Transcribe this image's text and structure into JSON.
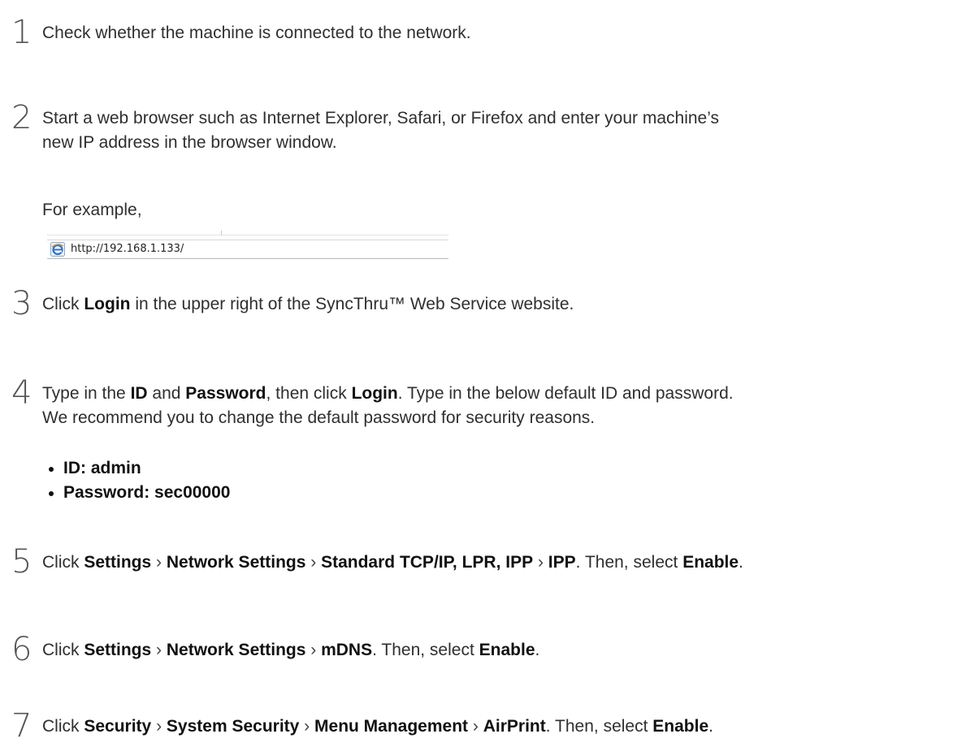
{
  "steps": [
    {
      "num": "1",
      "text": "Check whether the machine is connected to the network."
    },
    {
      "num": "2",
      "line1": "Start a web browser such as Internet Explorer, Safari, or Firefox and enter your machine’s",
      "line2": "new IP address in the browser window.",
      "example_label": "For example,",
      "address_url": "http://192.168.1.133/"
    },
    {
      "num": "3",
      "pre": "Click ",
      "login": "Login",
      "post": " in the upper right of the SyncThru™ Web Service website."
    },
    {
      "num": "4",
      "t1": "Type in the ",
      "id": "ID",
      "t2": " and ",
      "password": "Password",
      "t3": ", then click ",
      "login": "Login",
      "t4": ". Type in the below default ID and password.",
      "line2": "We recommend you to change the default password for security reasons.",
      "bullets": [
        "ID: admin",
        "Password: sec00000"
      ]
    },
    {
      "num": "5",
      "pre": "Click ",
      "items": [
        "Settings",
        "Network Settings",
        "Standard TCP/IP, LPR, IPP",
        "IPP"
      ],
      "then": ". Then, select ",
      "enable": "Enable",
      "end": "."
    },
    {
      "num": "6",
      "pre": "Click ",
      "items": [
        "Settings",
        "Network Settings",
        "mDNS"
      ],
      "then": ". Then, select ",
      "enable": "Enable",
      "end": "."
    },
    {
      "num": "7",
      "pre": "Click ",
      "items": [
        "Security",
        "System Security",
        "Menu Management",
        "AirPrint"
      ],
      "then": ". Then, select ",
      "enable": "Enable",
      "end": "."
    }
  ],
  "separator": "›"
}
